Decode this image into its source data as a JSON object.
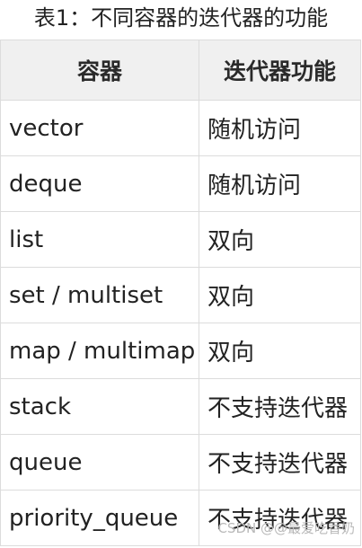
{
  "caption": "表1：不同容器的迭代器的功能",
  "table": {
    "headers": [
      "容器",
      "迭代器功能"
    ],
    "rows": [
      {
        "container": "vector",
        "function": "随机访问"
      },
      {
        "container": "deque",
        "function": "随机访问"
      },
      {
        "container": "list",
        "function": "双向"
      },
      {
        "container": "set / multiset",
        "function": "双向"
      },
      {
        "container": "map / multimap",
        "function": "双向"
      },
      {
        "container": "stack",
        "function": "不支持迭代器"
      },
      {
        "container": "queue",
        "function": "不支持迭代器"
      },
      {
        "container": "priority_queue",
        "function": "不支持迭代器"
      }
    ]
  },
  "watermark": "CSDN @@最爱吃香奶"
}
